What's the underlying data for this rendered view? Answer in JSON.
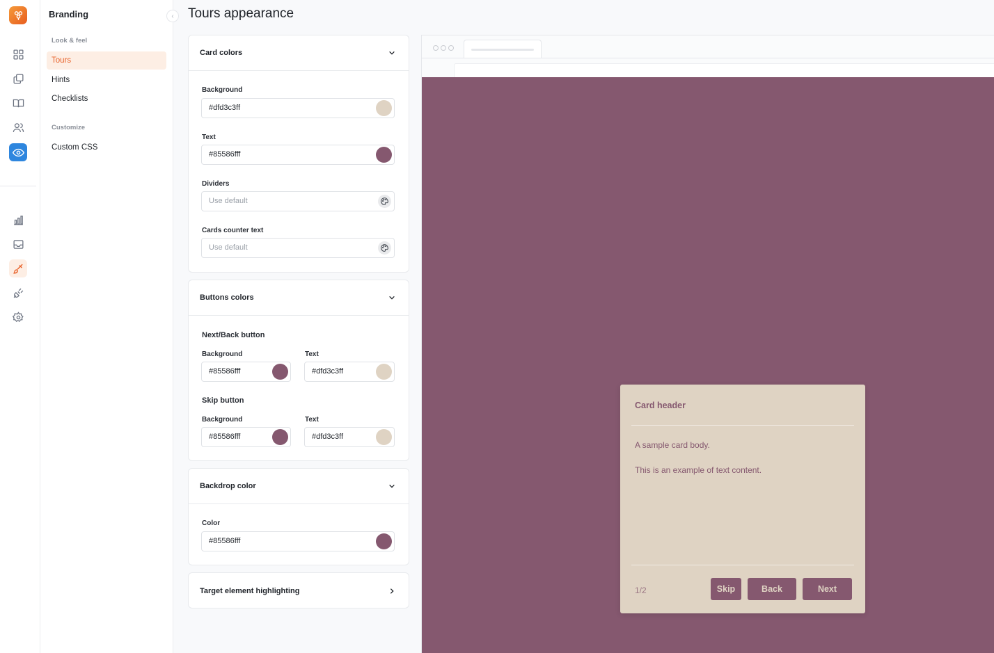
{
  "colors": {
    "brand_orange": "#e8622a",
    "active_blue": "#2e86de",
    "card_background": "#dfd3c3",
    "card_text": "#85586f",
    "backdrop": "#85586f"
  },
  "rail": {
    "icons": [
      "grid-icon",
      "copy-icon",
      "book-icon",
      "users-icon",
      "eye-icon",
      "bar-chart-icon",
      "inbox-icon",
      "brush-icon",
      "plug-icon",
      "gear-icon"
    ]
  },
  "subnav": {
    "title": "Branding",
    "collapse_glyph": "‹",
    "groups": [
      {
        "label": "Look & feel",
        "items": [
          "Tours",
          "Hints",
          "Checklists"
        ]
      },
      {
        "label": "Customize",
        "items": [
          "Custom CSS"
        ]
      }
    ],
    "active_item": "Tours"
  },
  "page": {
    "title": "Tours appearance"
  },
  "card_colors": {
    "title": "Card colors",
    "fields": [
      {
        "label": "Background",
        "value": "#dfd3c3ff",
        "swatch": "#dfd3c3"
      },
      {
        "label": "Text",
        "value": "#85586fff",
        "swatch": "#85586f"
      },
      {
        "label": "Dividers",
        "placeholder": "Use default"
      },
      {
        "label": "Cards counter text",
        "placeholder": "Use default"
      }
    ]
  },
  "buttons_colors": {
    "title": "Buttons colors",
    "next_back": {
      "heading": "Next/Back button",
      "background": {
        "label": "Background",
        "value": "#85586fff",
        "swatch": "#85586f"
      },
      "text": {
        "label": "Text",
        "value": "#dfd3c3ff",
        "swatch": "#dfd3c3"
      }
    },
    "skip": {
      "heading": "Skip button",
      "background": {
        "label": "Background",
        "value": "#85586fff",
        "swatch": "#85586f"
      },
      "text": {
        "label": "Text",
        "value": "#dfd3c3ff",
        "swatch": "#dfd3c3"
      }
    }
  },
  "backdrop_color": {
    "title": "Backdrop color",
    "field": {
      "label": "Color",
      "value": "#85586fff",
      "swatch": "#85586f"
    }
  },
  "target_highlighting": {
    "title": "Target element highlighting"
  },
  "preview_card": {
    "header": "Card header",
    "body_line1": "A sample card body.",
    "body_line2": "This is an example of text content.",
    "counter": "1/2",
    "skip_label": "Skip",
    "back_label": "Back",
    "next_label": "Next"
  }
}
